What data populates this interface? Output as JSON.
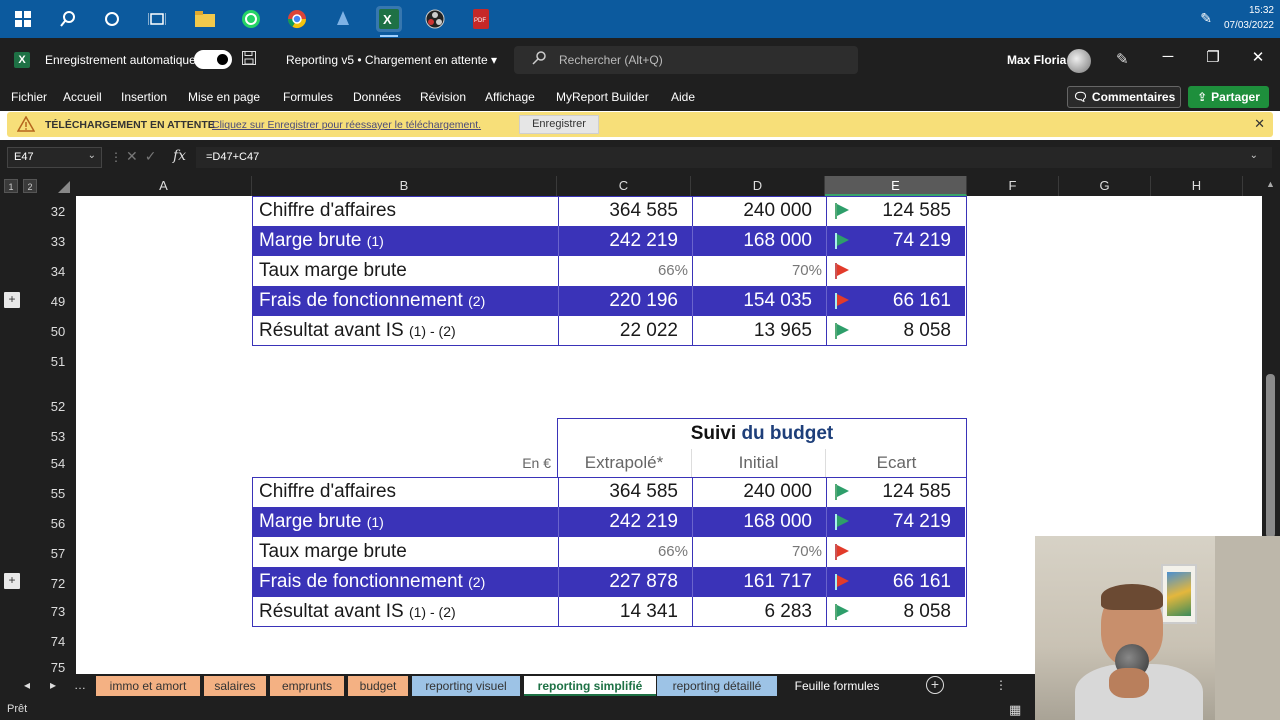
{
  "taskbar": {
    "icons": [
      "windows-start",
      "search",
      "cortana",
      "task-view",
      "file-explorer",
      "whatsapp",
      "chrome",
      "app",
      "excel",
      "obs",
      "pdf"
    ],
    "time": "15:32",
    "date": "07/03/2022"
  },
  "titlebar": {
    "autosave_label": "Enregistrement automatique",
    "doc_title": "Reporting v5 • Chargement en attente",
    "search_placeholder": "Rechercher (Alt+Q)",
    "user_name": "Max Floria"
  },
  "menu": {
    "items": [
      "Fichier",
      "Accueil",
      "Insertion",
      "Mise en page",
      "Formules",
      "Données",
      "Révision",
      "Affichage",
      "MyReport Builder",
      "Aide"
    ],
    "comments": "Commentaires",
    "share": "Partager"
  },
  "warning": {
    "title": "TÉLÉCHARGEMENT EN ATTENTE",
    "message": "Cliquez sur Enregistrer pour réessayer le téléchargement.",
    "button": "Enregistrer"
  },
  "formula_bar": {
    "name_box": "E47",
    "formula": "=D47+C47"
  },
  "columns": [
    "A",
    "B",
    "C",
    "D",
    "E",
    "F",
    "G",
    "H"
  ],
  "selected_column": "E",
  "outline_levels": [
    "1",
    "2"
  ],
  "rows": [
    "32",
    "33",
    "34",
    "49",
    "50",
    "51",
    "52",
    "53",
    "54",
    "55",
    "56",
    "57",
    "72",
    "73",
    "74",
    "75"
  ],
  "table1": [
    {
      "label": "Chiffre d'affaires",
      "sub": "",
      "c": "364 585",
      "d": "240 000",
      "e": "124 585",
      "flag": "green"
    },
    {
      "label": "Marge brute",
      "sub": "(1)",
      "c": "242 219",
      "d": "168 000",
      "e": "74 219",
      "flag": "green"
    },
    {
      "label": "Taux marge brute",
      "sub": "",
      "c": "66%",
      "d": "70%",
      "e": "",
      "flag": "red"
    },
    {
      "label": "Frais de fonctionnement",
      "sub": "(2)",
      "c": "220 196",
      "d": "154 035",
      "e": "66 161",
      "flag": "red"
    },
    {
      "label": "Résultat avant IS",
      "sub": "(1) - (2)",
      "c": "22 022",
      "d": "13 965",
      "e": "8 058",
      "flag": "green"
    }
  ],
  "budget": {
    "title_part1": "Suivi",
    "title_part2": "du budget",
    "unit": "En €",
    "col_c": "Extrapolé*",
    "col_d": "Initial",
    "col_e": "Ecart"
  },
  "table2": [
    {
      "label": "Chiffre d'affaires",
      "sub": "",
      "c": "364 585",
      "d": "240 000",
      "e": "124 585",
      "flag": "green"
    },
    {
      "label": "Marge brute",
      "sub": "(1)",
      "c": "242 219",
      "d": "168 000",
      "e": "74 219",
      "flag": "green"
    },
    {
      "label": "Taux marge brute",
      "sub": "",
      "c": "66%",
      "d": "70%",
      "e": "",
      "flag": "red"
    },
    {
      "label": "Frais de fonctionnement",
      "sub": "(2)",
      "c": "227 878",
      "d": "161 717",
      "e": "66 161",
      "flag": "red"
    },
    {
      "label": "Résultat avant IS",
      "sub": "(1) - (2)",
      "c": "14 341",
      "d": "6 283",
      "e": "8 058",
      "flag": "green"
    }
  ],
  "sheet_tabs": [
    {
      "label": "immo et amort",
      "color": "#f4b183"
    },
    {
      "label": "salaires",
      "color": "#f4b183"
    },
    {
      "label": "emprunts",
      "color": "#f4b183"
    },
    {
      "label": "budget",
      "color": "#f4b183"
    },
    {
      "label": "reporting visuel",
      "color": "#9dc3e6"
    },
    {
      "label": "reporting simplifié",
      "color": "#ffffff"
    },
    {
      "label": "reporting détaillé",
      "color": "#9dc3e6"
    },
    {
      "label": "Feuille formules",
      "color": "#1f1f1f"
    }
  ],
  "status": {
    "text": "Prêt"
  },
  "colors": {
    "dark_row": "#3a33b8",
    "flag_green": "#2e9e6a",
    "flag_red": "#e23b2a",
    "excel_green": "#1e7145"
  }
}
